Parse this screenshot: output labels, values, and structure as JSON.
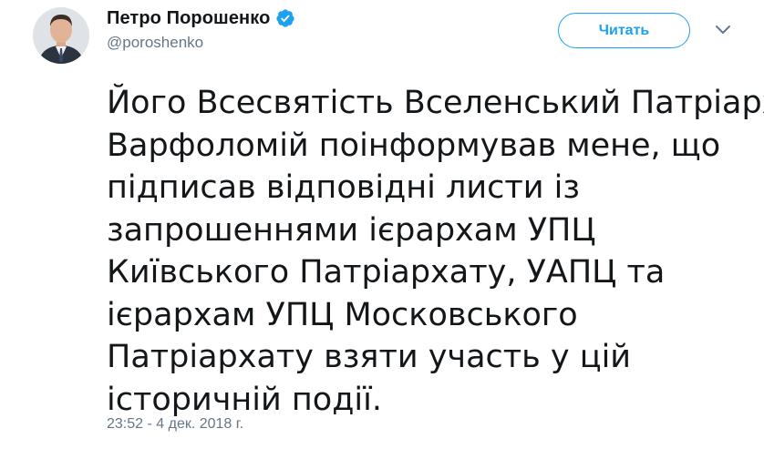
{
  "author": {
    "display_name": "Петро Порошенко",
    "handle": "@poroshenko",
    "verified": true
  },
  "follow_button": {
    "label": "Читать"
  },
  "tweet": {
    "lines": [
      "Його Всесвятість Вселенський Патріарх",
      "Варфоломій поінформував мене, що",
      "підписав відповідні листи із",
      "запрошеннями ієрархам УПЦ",
      "Київського Патріархату, УАПЦ та",
      "ієрархам УПЦ Московського",
      "Патріархату взяти участь у цій",
      "історичній події."
    ],
    "timestamp": "23:52 - 4 дек. 2018 г."
  },
  "colors": {
    "accent": "#1da1f2",
    "text_primary": "#14171a",
    "text_secondary": "#657786"
  },
  "icons": {
    "verified": "verified-badge-icon",
    "caret": "chevron-down-icon",
    "avatar": "avatar-photo"
  }
}
